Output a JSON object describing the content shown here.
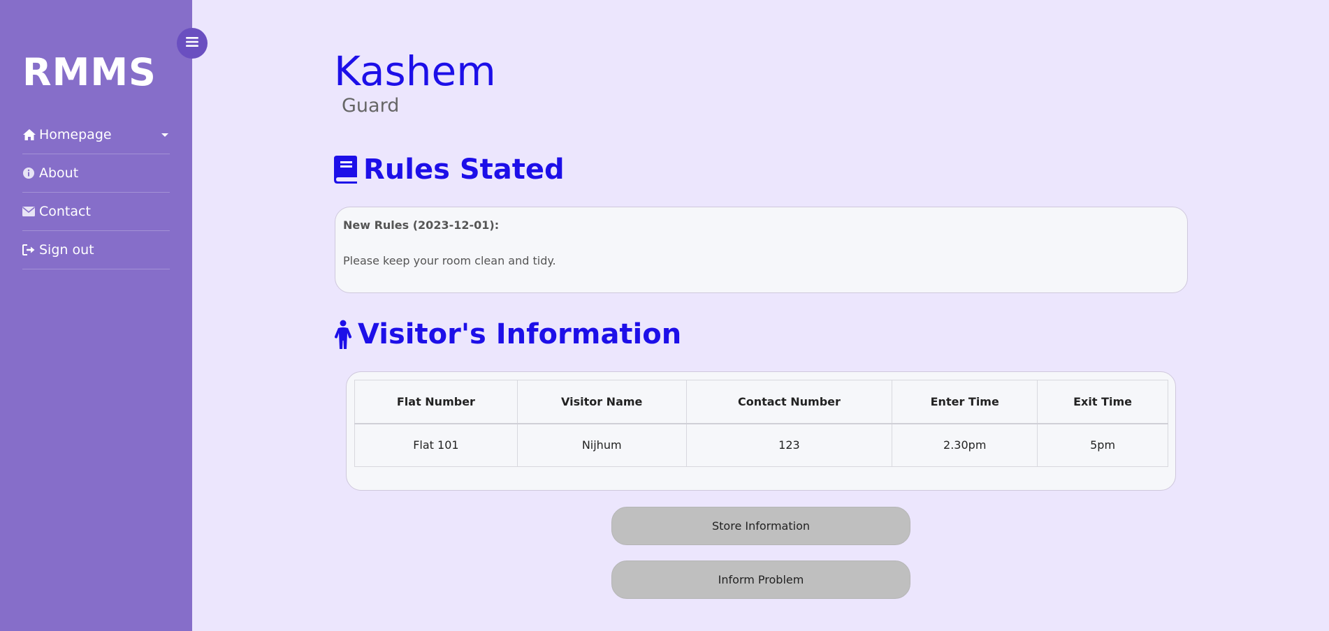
{
  "sidebar": {
    "brand": "RMMS",
    "items": [
      {
        "label": "Homepage",
        "icon": "home-icon"
      },
      {
        "label": "About",
        "icon": "info-icon"
      },
      {
        "label": "Contact",
        "icon": "envelope-icon"
      },
      {
        "label": "Sign out",
        "icon": "sign-out-icon"
      }
    ]
  },
  "user": {
    "name": "Kashem",
    "role": "Guard"
  },
  "rules": {
    "title": "Rules Stated",
    "heading": "New Rules (2023-12-01):",
    "body": "Please keep your room clean and tidy."
  },
  "visitors": {
    "title": "Visitor's Information",
    "columns": [
      "Flat Number",
      "Visitor Name",
      "Contact Number",
      "Enter Time",
      "Exit Time"
    ],
    "rows": [
      [
        "Flat 101",
        "Nijhum",
        "123",
        "2.30pm",
        "5pm"
      ]
    ]
  },
  "actions": {
    "store_label": "Store Information",
    "inform_label": "Inform Problem"
  },
  "colors": {
    "sidebar": "#866ec9",
    "accent": "#1d0fe8",
    "background": "#ece6fd",
    "button": "#bfbfbf"
  }
}
